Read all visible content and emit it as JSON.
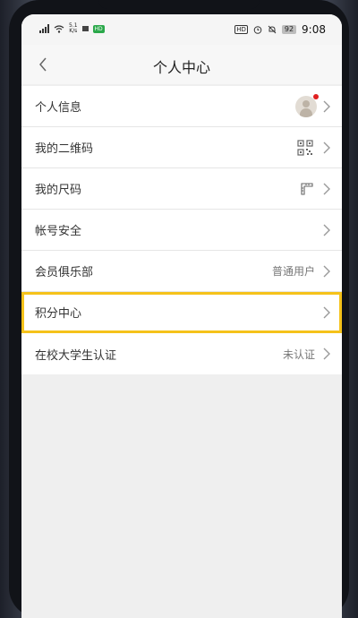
{
  "status_bar": {
    "signal_label": "4G",
    "net_speed_value": "5.1",
    "net_speed_unit": "K/s",
    "green_badge": "HD",
    "hd_label": "HD",
    "battery": "92",
    "time": "9:08"
  },
  "nav": {
    "title": "个人中心",
    "back_icon": "chevron-left-icon"
  },
  "rows": [
    {
      "label": "个人信息",
      "value": "",
      "icon": "avatar"
    },
    {
      "label": "我的二维码",
      "value": "",
      "icon": "qr-code-icon"
    },
    {
      "label": "我的尺码",
      "value": "",
      "icon": "ruler-icon"
    },
    {
      "label": "帐号安全",
      "value": "",
      "icon": ""
    },
    {
      "label": "会员俱乐部",
      "value": "普通用户",
      "icon": ""
    },
    {
      "label": "积分中心",
      "value": "",
      "icon": ""
    },
    {
      "label": "在校大学生认证",
      "value": "未认证",
      "icon": ""
    }
  ],
  "colors": {
    "highlight": "#f5c21a",
    "background": "#efefef",
    "notification_dot": "#e02020"
  }
}
